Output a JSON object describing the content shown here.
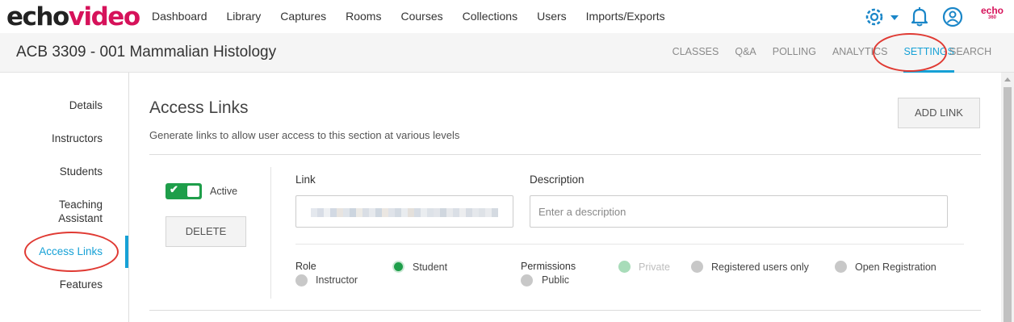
{
  "brand": {
    "logo_echo": "echo",
    "logo_video": "video",
    "corner_logo_top": "echo",
    "corner_logo_bottom": "360"
  },
  "nav": [
    "Dashboard",
    "Library",
    "Captures",
    "Rooms",
    "Courses",
    "Collections",
    "Users",
    "Imports/Exports"
  ],
  "icons": {
    "settings": "gear-icon",
    "notifications": "bell-icon",
    "account": "user-icon"
  },
  "course_title": "ACB 3309 - 001 Mammalian Histology",
  "tabs": [
    "CLASSES",
    "Q&A",
    "POLLING",
    "ANALYTICS",
    "SETTINGS",
    "SEARCH"
  ],
  "active_tab": "SETTINGS",
  "sidebar": [
    "Details",
    "Instructors",
    "Students",
    "Teaching Assistant",
    "Access Links",
    "Features"
  ],
  "active_sidebar": "Access Links",
  "section": {
    "title": "Access Links",
    "description": "Generate links to allow user access to this section at various levels",
    "add_button": "ADD LINK"
  },
  "link_entry": {
    "active_label": "Active",
    "active": true,
    "delete_button": "DELETE",
    "link_label": "Link",
    "description_label": "Description",
    "description_placeholder": "Enter a description",
    "role_label": "Role",
    "roles": [
      {
        "label": "Student",
        "selected": true
      },
      {
        "label": "Instructor",
        "selected": false
      }
    ],
    "permissions_label": "Permissions",
    "permissions": [
      {
        "label": "Private",
        "selected": true,
        "disabled": true
      },
      {
        "label": "Registered users only",
        "selected": false
      },
      {
        "label": "Open Registration",
        "selected": false
      },
      {
        "label": "Public",
        "selected": false
      }
    ]
  },
  "colors": {
    "accent": "#16a1d6",
    "brand": "#d6125a",
    "toggle_on": "#1e9e4a",
    "highlight_ring": "#e03a33"
  }
}
